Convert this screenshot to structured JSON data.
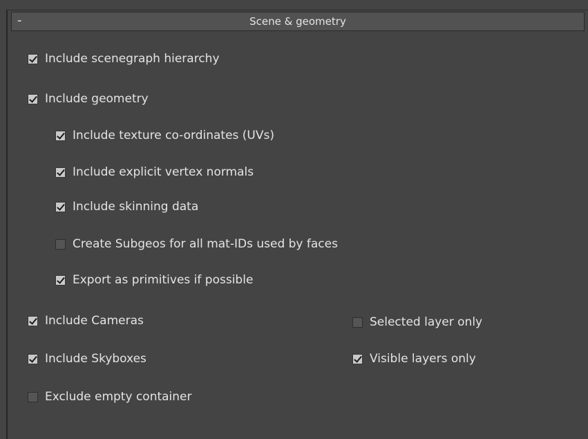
{
  "rollout": {
    "toggle": "-",
    "title": "Scene & geometry"
  },
  "options": {
    "include_scenegraph_hierarchy": {
      "label": "Include scenegraph hierarchy",
      "checked": true
    },
    "include_geometry": {
      "label": "Include geometry",
      "checked": true
    },
    "include_texture_coordinates": {
      "label": "Include texture co-ordinates (UVs)",
      "checked": true
    },
    "include_explicit_vertex_normals": {
      "label": "Include explicit vertex normals",
      "checked": true
    },
    "include_skinning_data": {
      "label": "Include skinning data",
      "checked": true
    },
    "create_subgeos": {
      "label": "Create Subgeos for all mat-IDs used by faces",
      "checked": false
    },
    "export_as_primitives": {
      "label": "Export as primitives if possible",
      "checked": true
    },
    "include_cameras": {
      "label": "Include Cameras",
      "checked": true
    },
    "selected_layer_only": {
      "label": "Selected layer only",
      "checked": false
    },
    "include_skyboxes": {
      "label": "Include Skyboxes",
      "checked": true
    },
    "visible_layers_only": {
      "label": "Visible layers only",
      "checked": true
    },
    "exclude_empty_container": {
      "label": "Exclude empty container",
      "checked": false
    }
  }
}
